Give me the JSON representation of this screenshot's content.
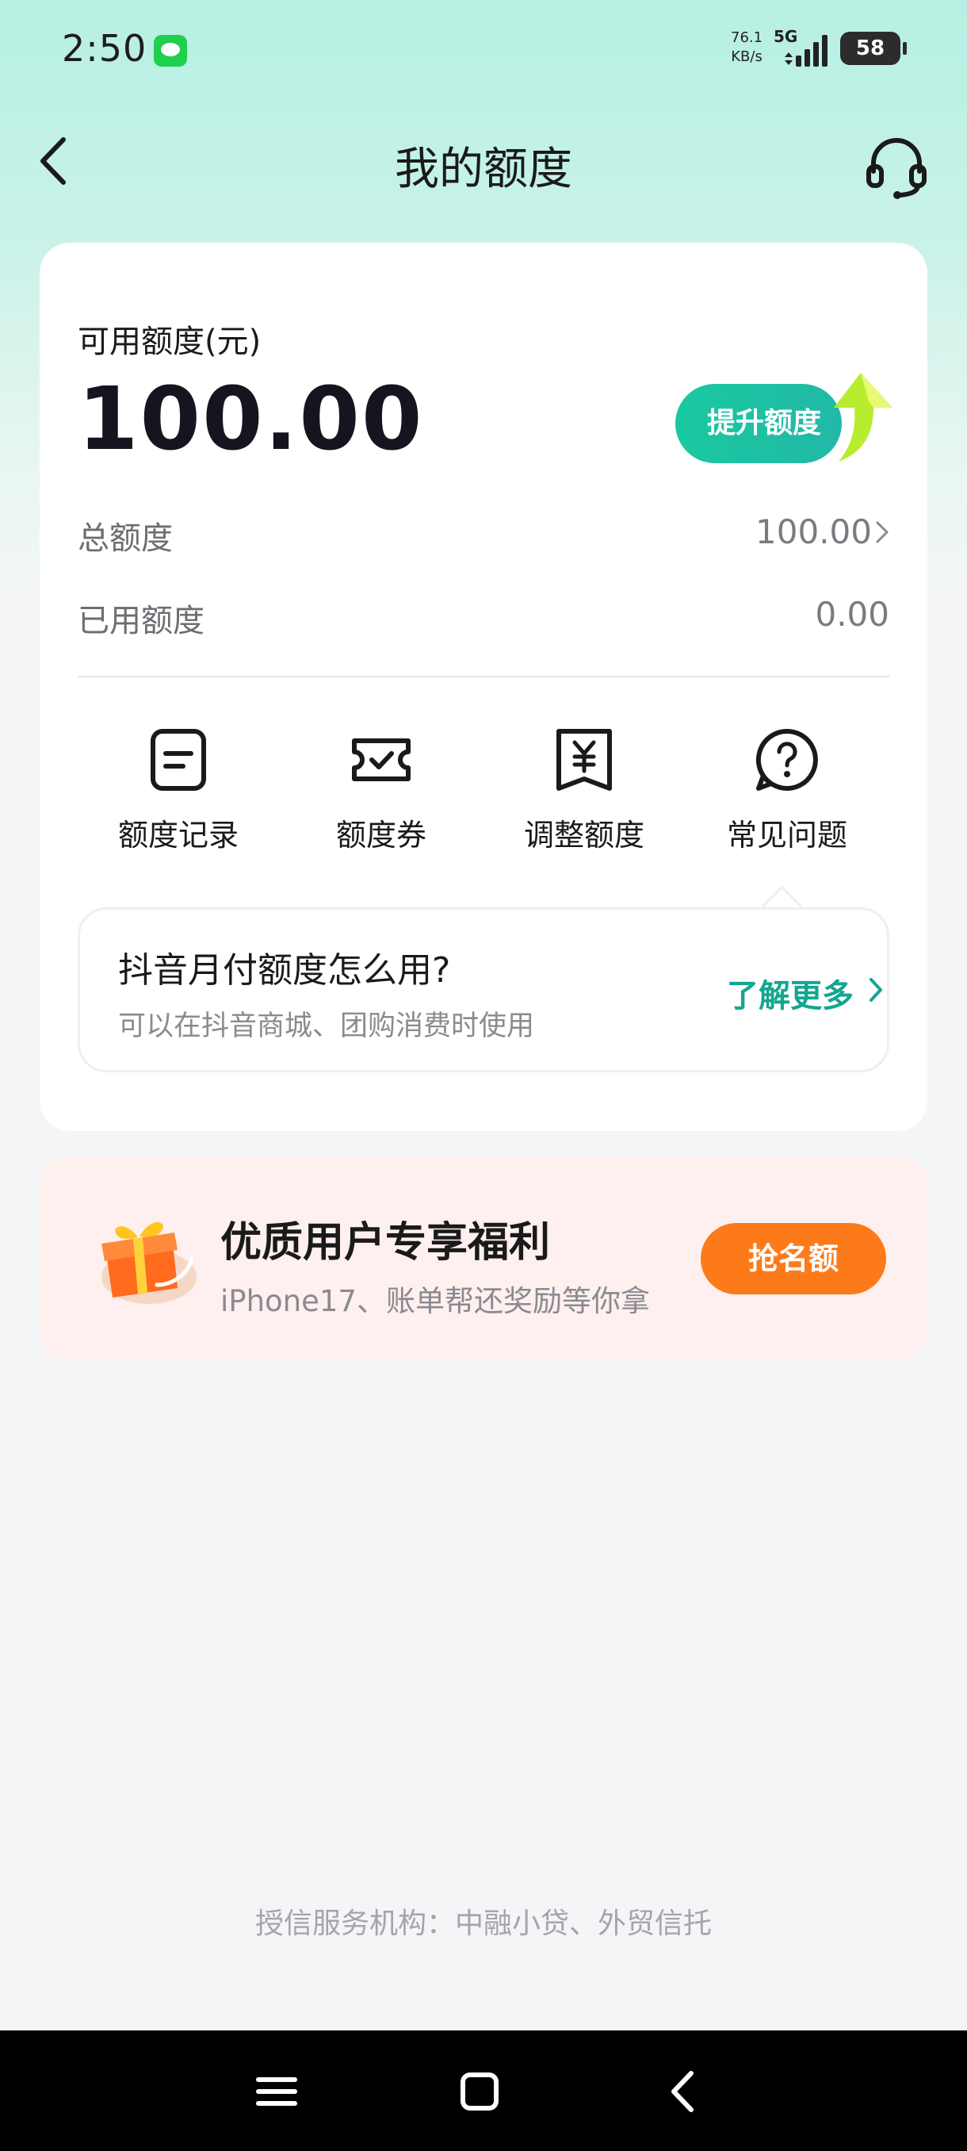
{
  "status_bar": {
    "time": "2:50",
    "net_speed_value": "76.1",
    "net_speed_unit": "KB/s",
    "network_type": "5G",
    "battery": "58"
  },
  "header": {
    "title": "我的额度"
  },
  "quota": {
    "available_label": "可用额度(元)",
    "available_amount": "100.00",
    "raise_button": "提升额度",
    "total_label": "总额度",
    "total_value": "100.00",
    "used_label": "已用额度",
    "used_value": "0.00"
  },
  "quick_actions": [
    {
      "label": "额度记录",
      "icon": "document-icon"
    },
    {
      "label": "额度券",
      "icon": "ticket-check-icon"
    },
    {
      "label": "调整额度",
      "icon": "yuan-tag-icon"
    },
    {
      "label": "常见问题",
      "icon": "question-icon"
    }
  ],
  "info": {
    "title": "抖音月付额度怎么用?",
    "subtitle": "可以在抖音商城、团购消费时使用",
    "link": "了解更多"
  },
  "benefit": {
    "title": "优质用户专享福利",
    "subtitle": "iPhone17、账单帮还奖励等你拿",
    "button": "抢名额"
  },
  "footer": {
    "text": "授信服务机构：中融小贷、外贸信托"
  },
  "colors": {
    "accent": "#14a68f",
    "raise_button": "#19c9a0",
    "grab_button": "#fd7a1b",
    "benefit_bg": "#fdf0ee"
  }
}
